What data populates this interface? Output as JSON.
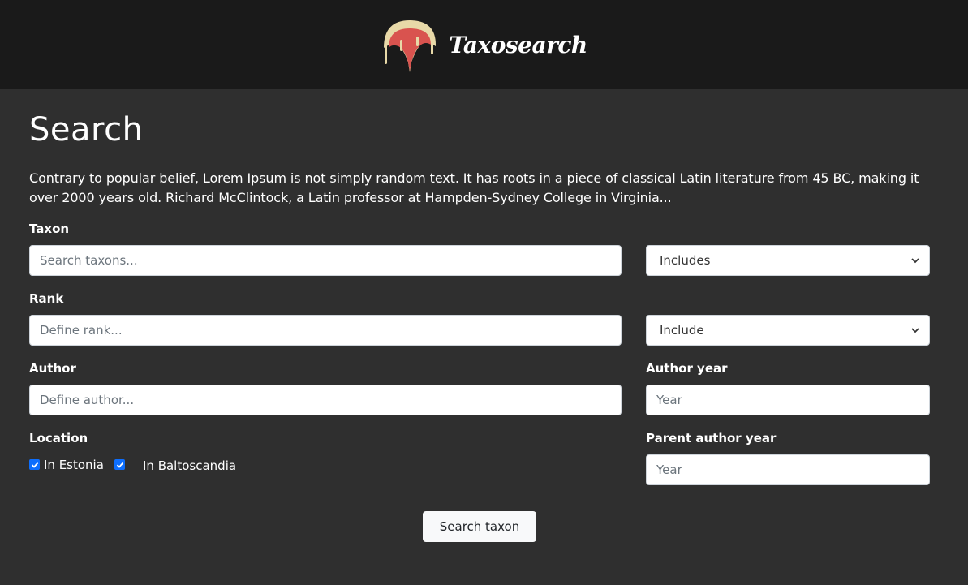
{
  "header": {
    "brand": "Taxosearch",
    "logo_icon": "mushroom-logo-icon"
  },
  "main": {
    "title": "Search",
    "description": "Contrary to popular belief, Lorem Ipsum is not simply random text. It has roots in a piece of classical Latin literature from 45 BC, making it over 2000 years old. Richard McClintock, a Latin professor at Hampden-Sydney College in Virginia..."
  },
  "form": {
    "taxon": {
      "label": "Taxon",
      "placeholder": "Search taxons...",
      "mode": "Includes"
    },
    "rank": {
      "label": "Rank",
      "placeholder": "Define rank...",
      "mode": "Include"
    },
    "author": {
      "label": "Author",
      "placeholder": "Define author..."
    },
    "author_year": {
      "label": "Author year",
      "placeholder": "Year"
    },
    "location": {
      "label": "Location",
      "options": [
        {
          "label": "In Estonia",
          "checked": true
        },
        {
          "label": "In Baltoscandia",
          "checked": true
        }
      ]
    },
    "parent_author_year": {
      "label": "Parent author year",
      "placeholder": "Year"
    },
    "submit_label": "Search taxon"
  },
  "colors": {
    "header_bg": "#1a1a1a",
    "page_bg": "#2f2f2f",
    "logo_cap": "#e8d9a8",
    "logo_inner": "#d9534f",
    "checkbox": "#0d6efd"
  }
}
